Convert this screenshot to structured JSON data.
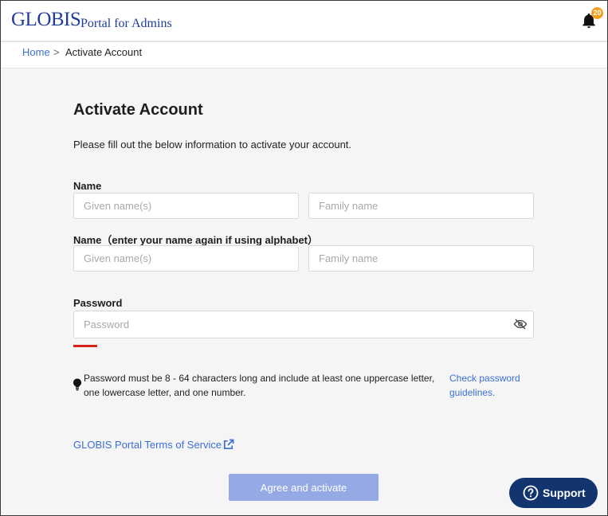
{
  "header": {
    "logo": "GLOBIS",
    "portal_name": "Portal for Admins",
    "notification_count": "20"
  },
  "breadcrumb": {
    "home": "Home",
    "separator": ">",
    "current": "Activate Account"
  },
  "form": {
    "title": "Activate Account",
    "description": "Please fill out the below information to activate your account.",
    "name_label": "Name",
    "given_name_placeholder": "Given name(s)",
    "family_name_placeholder": "Family name",
    "name_alpha_label": "Name（enter your name again if using alphabet）",
    "given_name_alpha_placeholder": "Given name(s)",
    "family_name_alpha_placeholder": "Family name",
    "password_label": "Password",
    "password_placeholder": "Password",
    "password_hint": "Password must be 8 - 64 characters long and include at least one uppercase letter, one lowercase letter, and one number.",
    "password_guidelines_link": "Check password guidelines.",
    "terms_link": "GLOBIS Portal Terms of Service",
    "submit_label": "Agree and activate"
  },
  "support": {
    "label": "Support"
  },
  "colors": {
    "brand": "#1f3d99",
    "link": "#3b6fd6",
    "button_disabled": "#95a9e4",
    "support_bg": "#12346f",
    "badge": "#f2a01c",
    "strength_bar": "#d9211c"
  },
  "icons": [
    "bell-icon",
    "eye-slash-icon",
    "lightbulb-icon",
    "external-link-icon",
    "question-circle-icon"
  ]
}
